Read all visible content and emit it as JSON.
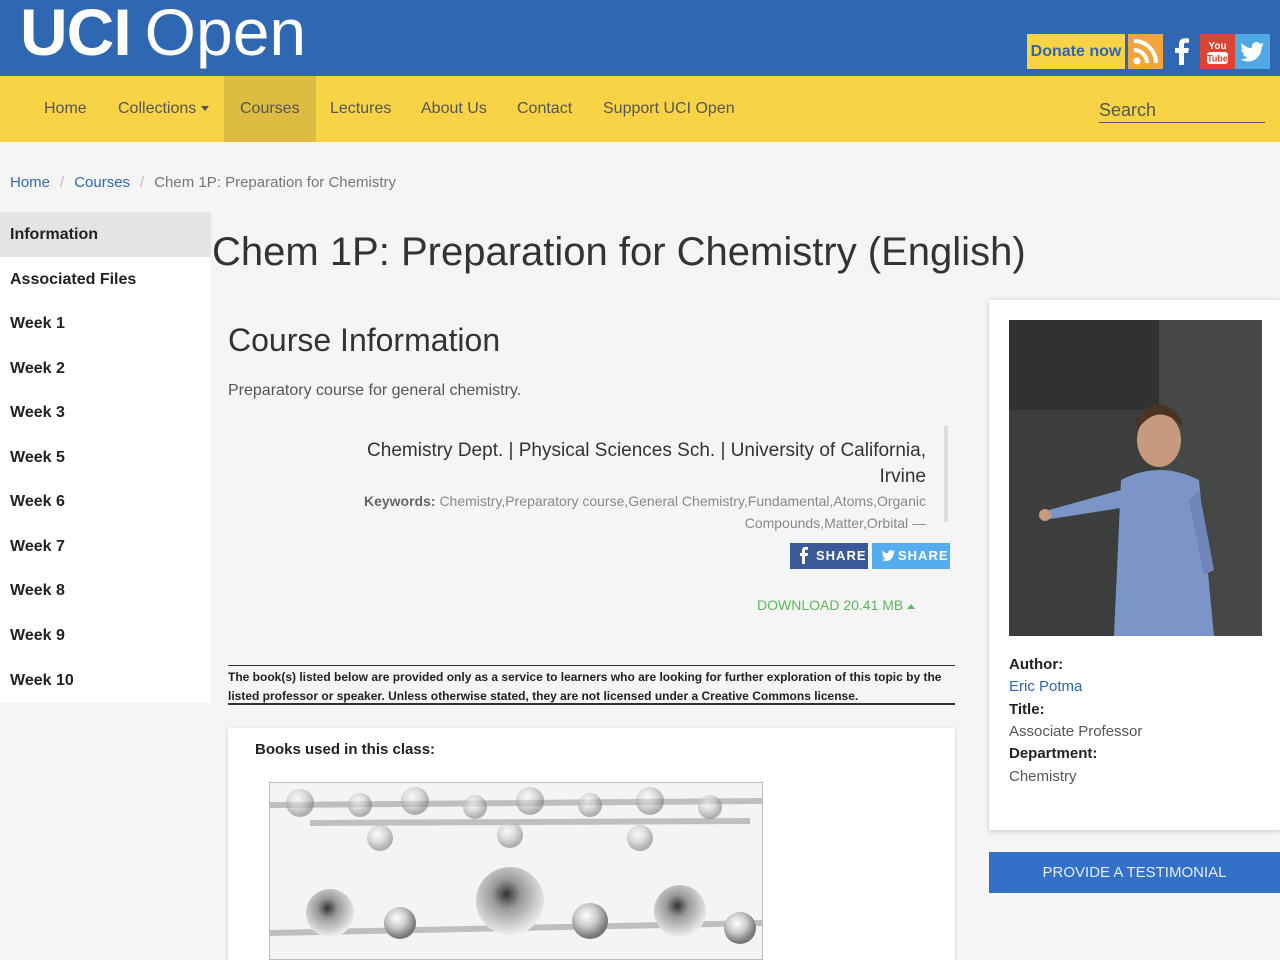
{
  "header": {
    "logo_bold": "UCI",
    "logo_light": "Open",
    "donate_label": "Donate now",
    "social_icons": [
      "rss-icon",
      "facebook-icon",
      "youtube-icon",
      "twitter-icon"
    ],
    "youtube_text_top": "You",
    "youtube_text_bottom": "Tube"
  },
  "nav": {
    "items": [
      "Home",
      "Collections",
      "Courses",
      "Lectures",
      "About Us",
      "Contact",
      "Support UCI Open"
    ],
    "active": "Courses",
    "search_placeholder": "Search"
  },
  "breadcrumb": {
    "home": "Home",
    "courses": "Courses",
    "separator": "/",
    "current": "Chem 1P: Preparation for Chemistry"
  },
  "sidebar": {
    "items": [
      "Information",
      "Associated Files",
      "Week 1",
      "Week 2",
      "Week 3",
      "Week 5",
      "Week 6",
      "Week 7",
      "Week 8",
      "Week 9",
      "Week 10"
    ],
    "active": "Information"
  },
  "main": {
    "page_title": "Chem 1P: Preparation for Chemistry (English)",
    "section_title": "Course Information",
    "description": "Preparatory course for general chemistry.",
    "department_line": "Chemistry Dept. | Physical Sciences Sch. | University of California, Irvine",
    "keywords_label": "Keywords:",
    "keywords_line1": "Chemistry,Preparatory course,General Chemistry,Fundamental,Atoms,Organic",
    "keywords_line2": "Compounds,Matter,Orbital —",
    "share_facebook": "SHARE",
    "share_twitter": "SHARE",
    "download_label": "DOWNLOAD 20.41 MB",
    "disclaimer": "The book(s) listed below are provided only as a service to learners who are looking for further exploration of this topic by the listed professor or speaker. Unless otherwise stated, they are not licensed under a Creative Commons license.",
    "books_title": "Books used in this class:"
  },
  "author_card": {
    "author_label": "Author:",
    "author_name": "Eric Potma",
    "title_label": "Title:",
    "title_value": "Associate Professor",
    "department_label": "Department:",
    "department_value": "Chemistry",
    "testimonial_button": "PROVIDE A TESTIMONIAL"
  },
  "colors": {
    "brand_blue": "#2f67b2",
    "brand_yellow": "#f7d345",
    "download_green": "#5cb85c",
    "facebook_blue": "#3b5998",
    "twitter_blue": "#55acee"
  }
}
